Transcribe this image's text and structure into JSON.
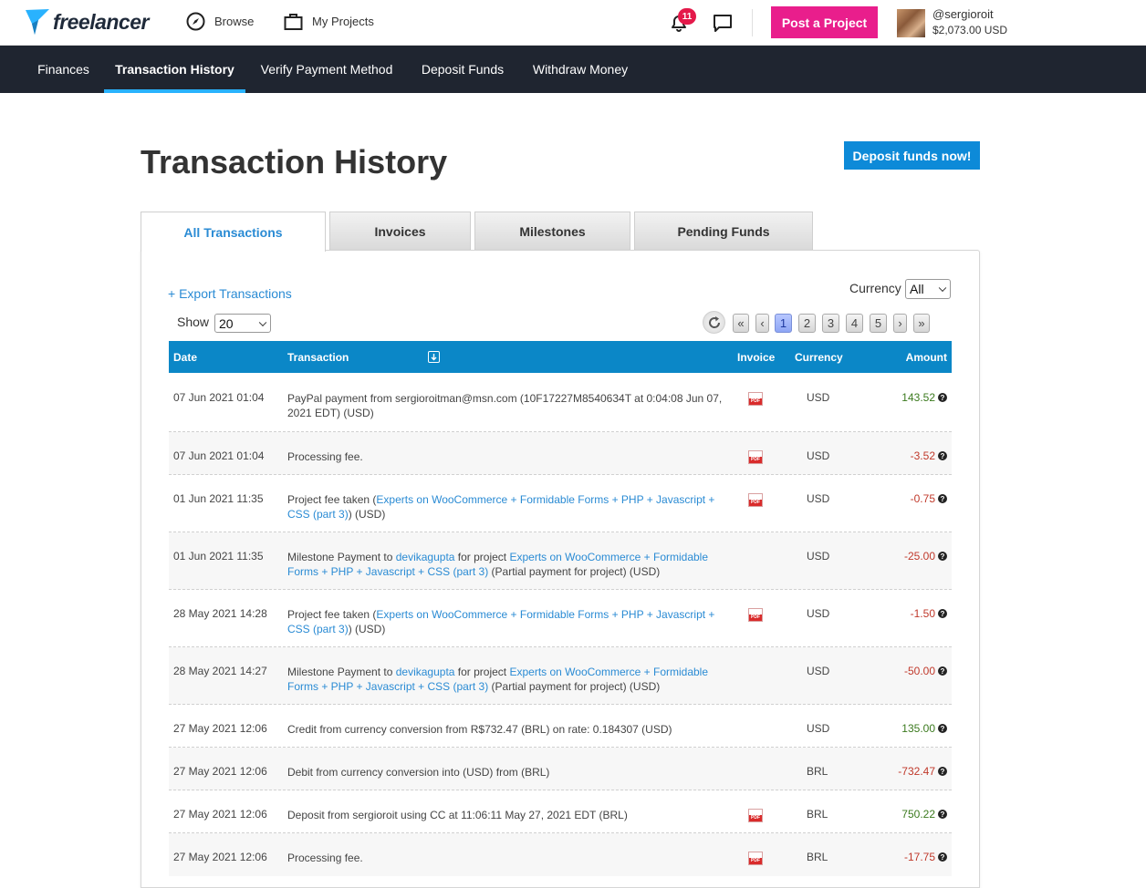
{
  "header": {
    "logo_text": "freelancer",
    "browse": "Browse",
    "my_projects": "My Projects",
    "notification_count": "11",
    "post_project": "Post a Project",
    "username": "@sergioroit",
    "balance": "$2,073.00 USD"
  },
  "subnav": [
    "Finances",
    "Transaction History",
    "Verify Payment Method",
    "Deposit Funds",
    "Withdraw Money"
  ],
  "page": {
    "title": "Transaction History",
    "deposit_button": "Deposit funds now!"
  },
  "tabs": [
    "All Transactions",
    "Invoices",
    "Milestones",
    "Pending Funds"
  ],
  "controls": {
    "export": "+ Export Transactions",
    "currency_label": "Currency",
    "currency_value": "All",
    "show_label": "Show",
    "show_value": "20",
    "pager": [
      "«",
      "‹",
      "1",
      "2",
      "3",
      "4",
      "5",
      "›",
      "»"
    ]
  },
  "table": {
    "headers": [
      "Date",
      "Transaction",
      "Invoice",
      "Currency",
      "Amount"
    ],
    "rows": [
      {
        "date": "07 Jun 2021 01:04",
        "tx": "PayPal payment from sergioroitman@msn.com (10F17227M8540634T at 0:04:08 Jun 07, 2021 EDT) (USD)",
        "pdf": true,
        "currency": "USD",
        "amount": "143.52"
      },
      {
        "date": "07 Jun 2021 01:04",
        "tx": "Processing fee.",
        "pdf": true,
        "currency": "USD",
        "amount": "-3.52"
      },
      {
        "date": "01 Jun 2021 11:35",
        "tx_pre": "Project fee taken (",
        "tx_link": "Experts on WooCommerce + Formidable Forms + PHP + Javascript + CSS (part 3)",
        "tx_post": ") (USD)",
        "pdf": true,
        "currency": "USD",
        "amount": "-0.75"
      },
      {
        "date": "01 Jun 2021 11:35",
        "tx_pre": "Milestone Payment to ",
        "tx_user": "devikagupta",
        "tx_mid": " for project ",
        "tx_link": "Experts on WooCommerce + Formidable Forms + PHP + Javascript + CSS (part 3)",
        "tx_post": " (Partial payment for project) (USD)",
        "pdf": false,
        "currency": "USD",
        "amount": "-25.00"
      },
      {
        "date": "28 May 2021 14:28",
        "tx_pre": "Project fee taken (",
        "tx_link": "Experts on WooCommerce + Formidable Forms + PHP + Javascript + CSS (part 3)",
        "tx_post": ") (USD)",
        "pdf": true,
        "currency": "USD",
        "amount": "-1.50"
      },
      {
        "date": "28 May 2021 14:27",
        "tx_pre": "Milestone Payment to ",
        "tx_user": "devikagupta",
        "tx_mid": " for project ",
        "tx_link": "Experts on WooCommerce + Formidable Forms + PHP + Javascript + CSS (part 3)",
        "tx_post": " (Partial payment for project) (USD)",
        "pdf": false,
        "currency": "USD",
        "amount": "-50.00"
      },
      {
        "date": "27 May 2021 12:06",
        "tx": "Credit from currency conversion from R$732.47 (BRL) on rate: 0.184307 (USD)",
        "pdf": false,
        "currency": "USD",
        "amount": "135.00"
      },
      {
        "date": "27 May 2021 12:06",
        "tx": "Debit from currency conversion into (USD) from (BRL)",
        "pdf": false,
        "currency": "BRL",
        "amount": "-732.47"
      },
      {
        "date": "27 May 2021 12:06",
        "tx": "Deposit from sergioroit using CC at 11:06:11 May 27, 2021 EDT (BRL)",
        "pdf": true,
        "currency": "BRL",
        "amount": "750.22"
      },
      {
        "date": "27 May 2021 12:06",
        "tx": "Processing fee.",
        "pdf": true,
        "currency": "BRL",
        "amount": "-17.75"
      }
    ]
  },
  "colors": {
    "accent": "#0b87c7",
    "post_button": "#e91e8c",
    "positive": "#3b7a1e",
    "negative": "#c0392b",
    "nav_bg": "#1f2530"
  }
}
